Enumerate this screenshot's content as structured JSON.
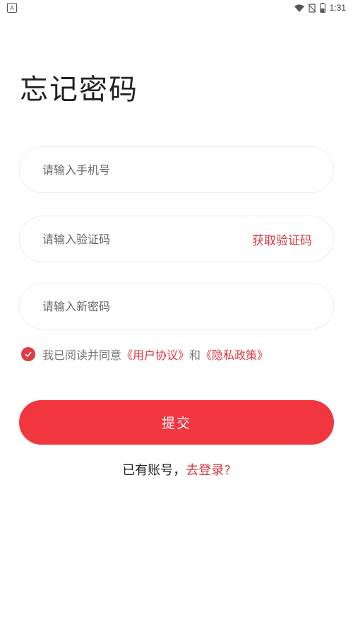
{
  "status_bar": {
    "left_icon_letter": "A",
    "time": "1:31",
    "icons": [
      "wifi-icon",
      "no-sim-icon",
      "battery-icon"
    ]
  },
  "page": {
    "title": "忘记密码"
  },
  "form": {
    "phone_placeholder": "请输入手机号",
    "code_placeholder": "请输入验证码",
    "get_code_label": "获取验证码",
    "new_password_placeholder": "请输入新密码"
  },
  "agreement": {
    "checked": true,
    "prefix": "我已阅读并同意",
    "user_agreement": "《用户协议》",
    "conjunction": "和",
    "privacy_policy": "《隐私政策》"
  },
  "submit": {
    "label": "提交"
  },
  "login_prompt": {
    "text": "已有账号，",
    "link": "去登录?"
  },
  "colors": {
    "accent": "#f2363f",
    "link": "#d9363e"
  }
}
